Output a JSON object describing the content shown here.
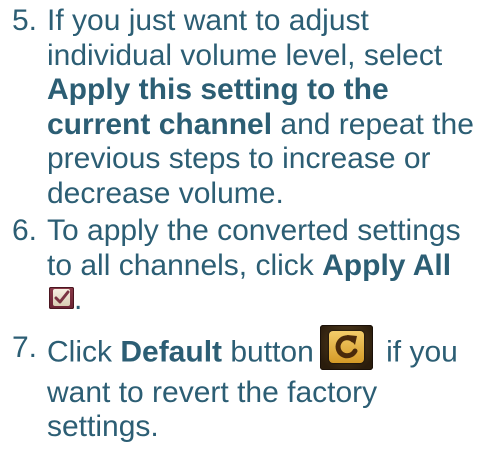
{
  "steps": [
    {
      "number": "5.",
      "segments": [
        "If you just want to adjust individual volume level, select ",
        "Apply this setting to the current channel",
        " and repeat the previous steps to increase or decrease volume."
      ]
    },
    {
      "number": "6.",
      "segments": [
        "To apply the converted settings to all channels, click ",
        "Apply All",
        "."
      ],
      "icon": "apply-all-checkmark-icon"
    },
    {
      "number": "7.",
      "segments": [
        "Click ",
        "Default",
        " button",
        " if you want to revert the factory settings."
      ],
      "icon": "default-reset-icon"
    }
  ],
  "colors": {
    "text": "#2c5e74",
    "apply_icon_bg": "#6a2434",
    "default_icon_bg": "#2a1c0c",
    "default_icon_face": "#e8b640"
  }
}
